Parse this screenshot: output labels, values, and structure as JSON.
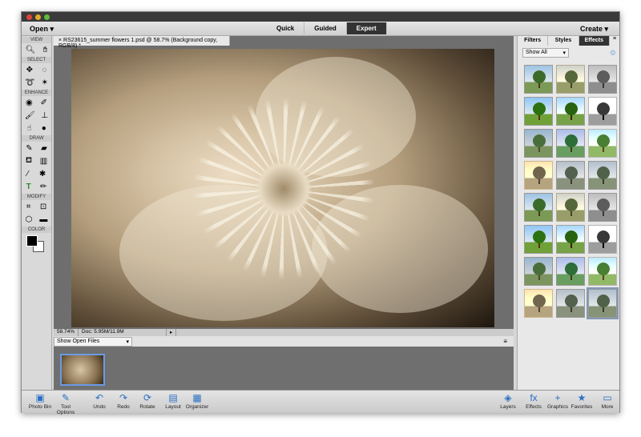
{
  "menu": {
    "open": "Open",
    "create": "Create",
    "modes": [
      "Quick",
      "Guided",
      "Expert"
    ]
  },
  "tools": {
    "sections": [
      "VIEW",
      "SELECT",
      "ENHANCE",
      "DRAW",
      "MODIFY",
      "COLOR"
    ]
  },
  "document": {
    "tab": "× RS23615_summer flowers 1.psd @ 58.7% (Background copy, RGB/8) *",
    "zoom": "58.74%",
    "doc_size": "Doc: 5.95M/11.9M"
  },
  "photo_bin": {
    "selector": "Show Open Files"
  },
  "panel": {
    "tabs": [
      "Filters",
      "Styles",
      "Effects"
    ],
    "filter": "Show All",
    "effects_count": 24
  },
  "bottom_left": [
    {
      "icon": "photo-bin-icon",
      "label": "Photo Bin",
      "glyph": "▣"
    },
    {
      "icon": "tool-options-icon",
      "label": "Tool Options",
      "glyph": "✎"
    },
    {
      "icon": "undo-icon",
      "label": "Undo",
      "glyph": "↶"
    },
    {
      "icon": "redo-icon",
      "label": "Redo",
      "glyph": "↷"
    },
    {
      "icon": "rotate-icon",
      "label": "Rotate",
      "glyph": "⟳"
    },
    {
      "icon": "layout-icon",
      "label": "Layout",
      "glyph": "▤"
    },
    {
      "icon": "organizer-icon",
      "label": "Organizer",
      "glyph": "▦"
    }
  ],
  "bottom_right": [
    {
      "icon": "layers-icon",
      "label": "Layers",
      "glyph": "◈"
    },
    {
      "icon": "effects-icon",
      "label": "Effects",
      "glyph": "fx"
    },
    {
      "icon": "graphics-icon",
      "label": "Graphics",
      "glyph": "+"
    },
    {
      "icon": "favorites-icon",
      "label": "Favorites",
      "glyph": "★"
    },
    {
      "icon": "more-icon",
      "label": "More",
      "glyph": "▭"
    }
  ]
}
